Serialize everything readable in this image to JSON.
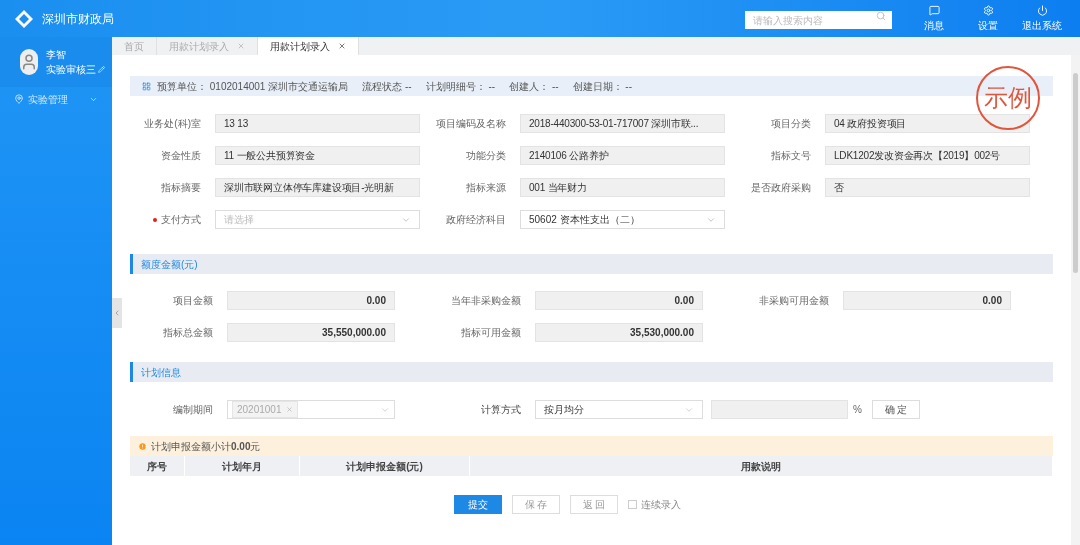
{
  "header": {
    "title": "深圳市财政局",
    "search": {
      "placeholder": "请输入搜索内容"
    },
    "actions": [
      {
        "kind": "message",
        "label": "消息"
      },
      {
        "kind": "settings",
        "label": "设置"
      },
      {
        "kind": "power",
        "label": "退出系统"
      }
    ]
  },
  "sidebar": {
    "user": {
      "name": "李智",
      "role": "实验审核三"
    },
    "items": [
      {
        "label": "实验管理",
        "expanded": false
      }
    ]
  },
  "tabs": [
    {
      "label": "首页",
      "closable": false,
      "selected": false
    },
    {
      "label": "用款计划录入",
      "closable": true,
      "selected": false
    },
    {
      "label": "用款计划录入",
      "closable": true,
      "selected": true
    }
  ],
  "info_bar": [
    {
      "label": "预算单位：",
      "value": "0102014001 深圳市交通运输局"
    },
    {
      "label": "流程状态",
      "value": "--"
    },
    {
      "label": "计划明细号：",
      "value": "--"
    },
    {
      "label": "创建人：",
      "value": "--"
    },
    {
      "label": "创建日期：",
      "value": "--"
    }
  ],
  "stamp": "示例",
  "form": [
    {
      "label": "业务处(科)室",
      "kind": "text",
      "value": "13 13",
      "required": false
    },
    {
      "label": "项目编码及名称",
      "kind": "text",
      "value": "2018-440300-53-01-717007 深圳市联...",
      "required": false
    },
    {
      "label": "项目分类",
      "kind": "text",
      "value": "04 政府投资项目",
      "required": false
    },
    {
      "label": "资金性质",
      "kind": "text",
      "value": "11 一般公共预算资金",
      "required": false
    },
    {
      "label": "功能分类",
      "kind": "text",
      "value": "2140106 公路养护",
      "required": false
    },
    {
      "label": "指标文号",
      "kind": "text",
      "value": "LDK1202发改资金再次【2019】002号",
      "required": false
    },
    {
      "label": "指标摘要",
      "kind": "text",
      "value": "深圳市联网立体停车库建设项目-光明新",
      "required": false
    },
    {
      "label": "指标来源",
      "kind": "text",
      "value": "001 当年财力",
      "required": false
    },
    {
      "label": "是否政府采购",
      "kind": "text",
      "value": "否",
      "required": false
    },
    {
      "label": "支付方式",
      "kind": "select",
      "placeholder": "请选择",
      "required": true
    },
    {
      "label": "政府经济科目",
      "kind": "select",
      "value": "50602 资本性支出（二）",
      "required": false
    }
  ],
  "amount_section": {
    "title": "额度金额(元)",
    "fields": [
      {
        "label": "项目金额",
        "value": "0.00"
      },
      {
        "label": "当年非采购金额",
        "value": "0.00"
      },
      {
        "label": "非采购可用金额",
        "value": "0.00"
      },
      {
        "label": "指标总金额",
        "value": "35,550,000.00"
      },
      {
        "label": "指标可用金额",
        "value": "35,530,000.00"
      }
    ]
  },
  "plan_section": {
    "title": "计划信息",
    "period": {
      "label": "编制期间",
      "tag": "20201001"
    },
    "method": {
      "label": "计算方式",
      "value": "按月均分"
    },
    "percent_unit": "%",
    "confirm": "确 定"
  },
  "subtotal": {
    "label": "计划申报金额小计",
    "amount": "0.00",
    "unit": "元"
  },
  "table": {
    "columns": [
      "序号",
      "计划年月",
      "计划申报金额(元)",
      "用款说明"
    ]
  },
  "footer": {
    "buttons": [
      {
        "label": "提交",
        "primary": true
      },
      {
        "label": "保 存",
        "primary": false
      },
      {
        "label": "返 回",
        "primary": false
      }
    ],
    "continuous": {
      "label": "连续录入",
      "checked": false
    }
  }
}
